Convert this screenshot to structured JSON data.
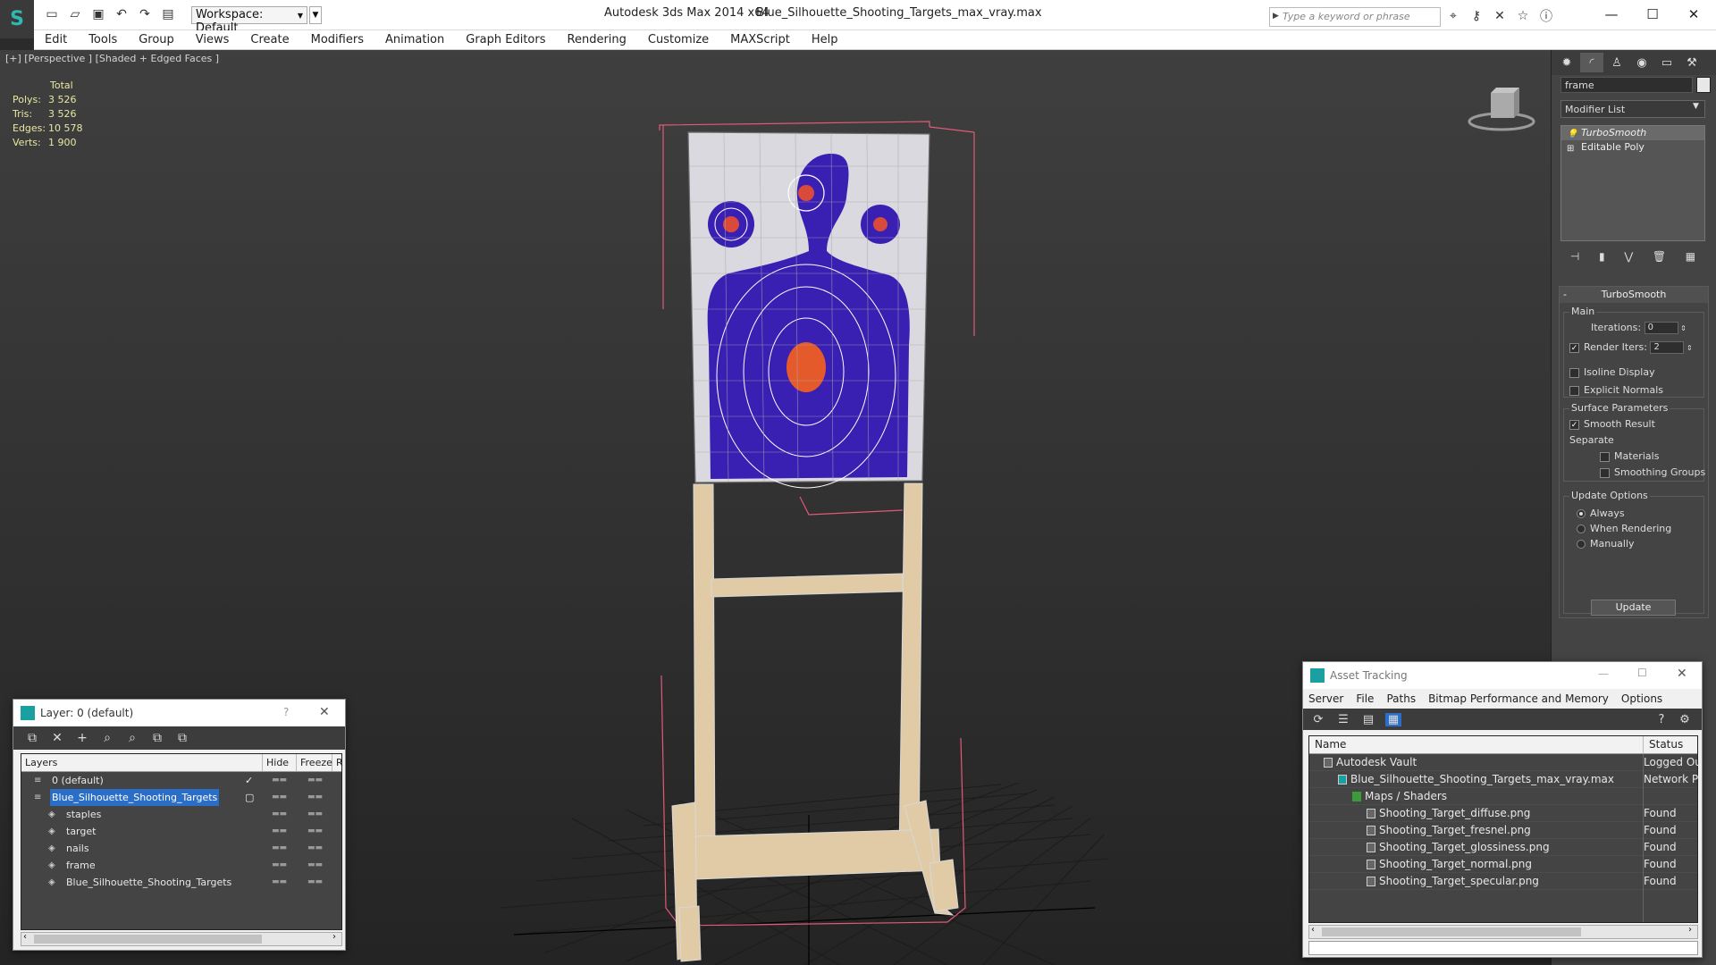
{
  "titlebar": {
    "workspace": "Workspace: Default",
    "app_title": "Autodesk 3ds Max  2014 x64",
    "file_name": "Blue_Silhouette_Shooting_Targets_max_vray.max",
    "search_placeholder": "Type a keyword or phrase"
  },
  "menus": [
    "Edit",
    "Tools",
    "Group",
    "Views",
    "Create",
    "Modifiers",
    "Animation",
    "Graph Editors",
    "Rendering",
    "Customize",
    "MAXScript",
    "Help"
  ],
  "viewport": {
    "label": "[+] [Perspective ] [Shaded + Edged Faces ]",
    "stats": {
      "header": "Total",
      "rows": [
        {
          "label": "Polys:",
          "value": "3 526"
        },
        {
          "label": "Tris:",
          "value": "3 526"
        },
        {
          "label": "Edges:",
          "value": "10 578"
        },
        {
          "label": "Verts:",
          "value": "1 900"
        }
      ]
    }
  },
  "command_panel": {
    "object_name": "frame",
    "modifier_list": "Modifier List",
    "stack": [
      "TurboSmooth",
      "Editable Poly"
    ],
    "rollout_title": "TurboSmooth",
    "main_group": "Main",
    "iterations_label": "Iterations:",
    "iterations_value": "0",
    "render_iters_label": "Render Iters:",
    "render_iters_value": "2",
    "isoline": "Isoline Display",
    "explicit_normals": "Explicit Normals",
    "surface_group": "Surface Parameters",
    "smooth_result": "Smooth Result",
    "separate": "Separate",
    "materials": "Materials",
    "smoothing_groups": "Smoothing Groups",
    "update_group": "Update Options",
    "always": "Always",
    "when_rendering": "When Rendering",
    "manually": "Manually",
    "update_button": "Update"
  },
  "layer_dialog": {
    "title": "Layer: 0 (default)",
    "help": "?",
    "columns": [
      "Layers",
      "Hide",
      "Freeze",
      "R"
    ],
    "rows": [
      {
        "name": "0 (default)",
        "indent": 0
      },
      {
        "name": "Blue_Silhouette_Shooting_Targets",
        "indent": 0
      },
      {
        "name": "staples",
        "indent": 1
      },
      {
        "name": "target",
        "indent": 1
      },
      {
        "name": "nails",
        "indent": 1
      },
      {
        "name": "frame",
        "indent": 1
      },
      {
        "name": "Blue_Silhouette_Shooting_Targets",
        "indent": 1
      }
    ]
  },
  "asset_dialog": {
    "title": "Asset Tracking",
    "menus": [
      "Server",
      "File",
      "Paths",
      "Bitmap Performance and Memory",
      "Options"
    ],
    "col_name": "Name",
    "col_status": "Status",
    "rows": [
      {
        "name": "Autodesk Vault",
        "status": "Logged Ou",
        "indent": 1
      },
      {
        "name": "Blue_Silhouette_Shooting_Targets_max_vray.max",
        "status": "Network Pa",
        "indent": 2
      },
      {
        "name": "Maps / Shaders",
        "status": "",
        "indent": 3
      },
      {
        "name": "Shooting_Target_diffuse.png",
        "status": "Found",
        "indent": 4
      },
      {
        "name": "Shooting_Target_fresnel.png",
        "status": "Found",
        "indent": 4
      },
      {
        "name": "Shooting_Target_glossiness.png",
        "status": "Found",
        "indent": 4
      },
      {
        "name": "Shooting_Target_normal.png",
        "status": "Found",
        "indent": 4
      },
      {
        "name": "Shooting_Target_specular.png",
        "status": "Found",
        "indent": 4
      }
    ]
  }
}
